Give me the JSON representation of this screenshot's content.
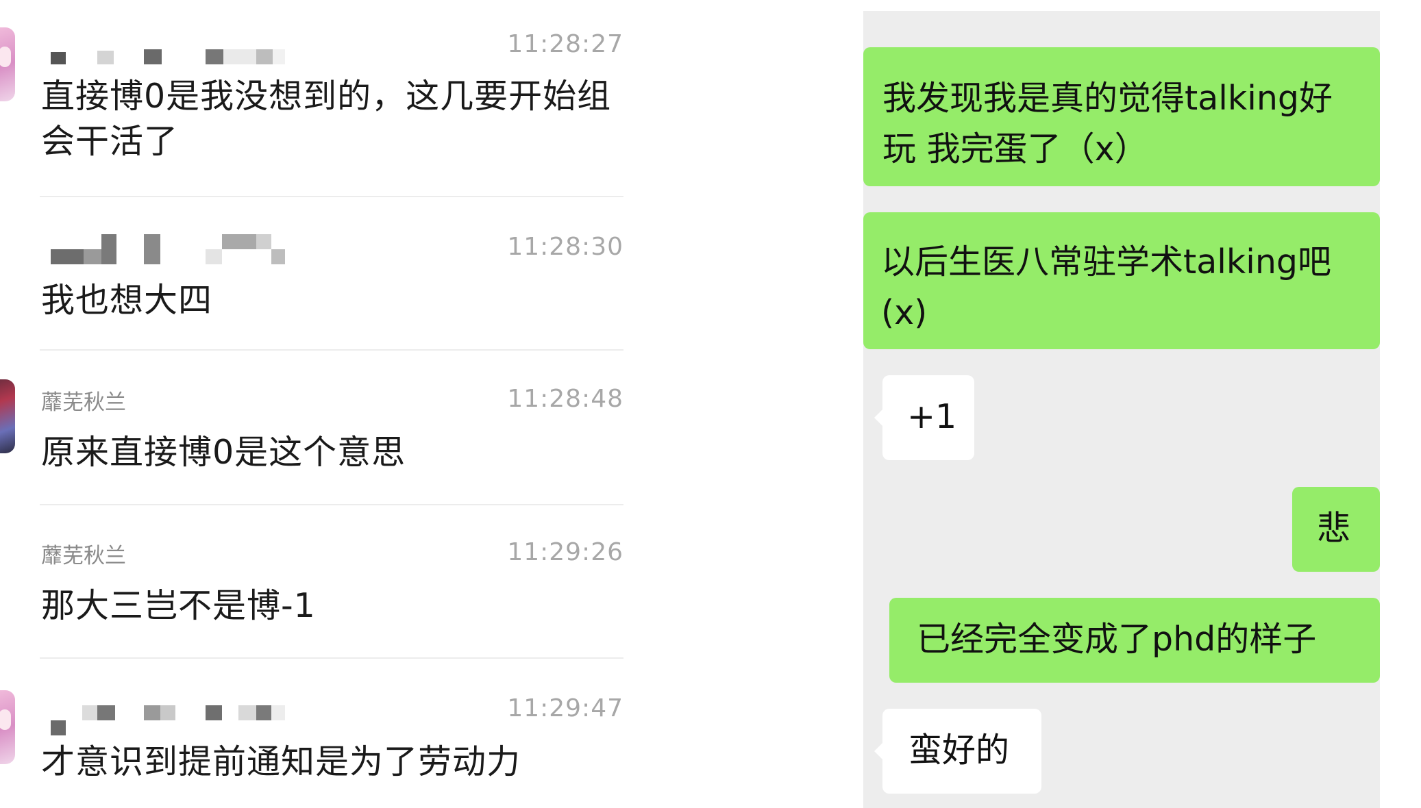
{
  "history": {
    "items": [
      {
        "name": "",
        "time": "11:28:27",
        "text": "直接博0是我没想到的，这几要开始组会干活了",
        "avatar": "pink"
      },
      {
        "name": "",
        "time": "11:28:30",
        "text": "我也想大四",
        "avatar": "none"
      },
      {
        "name": "蘼芜秋兰",
        "time": "11:28:48",
        "text": "原来直接博0是这个意思",
        "avatar": "dark"
      },
      {
        "name": "蘼芜秋兰",
        "time": "11:29:26",
        "text": "那大三岂不是博-1",
        "avatar": "none"
      },
      {
        "name": "",
        "time": "11:29:47",
        "text": "才意识到提前通知是为了劳动力",
        "avatar": "pink"
      }
    ]
  },
  "chat": {
    "messages": [
      {
        "side": "sent",
        "text": "我发现我是真的觉得talking好玩 我完蛋了（x）"
      },
      {
        "side": "sent",
        "text": "以后生医八常驻学术talking吧(x)"
      },
      {
        "side": "recv",
        "text": "+1"
      },
      {
        "side": "sent",
        "text": "悲"
      },
      {
        "side": "sent",
        "text": "已经完全变成了phd的样子"
      },
      {
        "side": "recv",
        "text": "蛮好的"
      }
    ]
  },
  "colors": {
    "sent_bubble": "#95ec69",
    "recv_bubble": "#ffffff",
    "chat_background": "#ededed",
    "time_text": "#a7a7a7",
    "name_text": "#8a8a8a"
  }
}
